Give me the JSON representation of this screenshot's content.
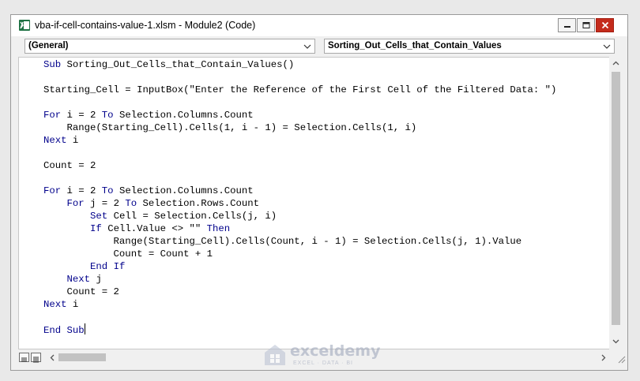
{
  "window": {
    "title": "vba-if-cell-contains-value-1.xlsm - Module2 (Code)"
  },
  "dropdowns": {
    "object": "(General)",
    "procedure": "Sorting_Out_Cells_that_Contain_Values"
  },
  "code_lines": [
    [
      {
        "t": "Sub",
        "k": true
      },
      {
        "t": " Sorting_Out_Cells_that_Contain_Values()"
      }
    ],
    [],
    [
      {
        "t": "Starting_Cell = InputBox(\"Enter the Reference of the First Cell of the Filtered Data: \")"
      }
    ],
    [],
    [
      {
        "t": "For",
        "k": true
      },
      {
        "t": " i = 2 "
      },
      {
        "t": "To",
        "k": true
      },
      {
        "t": " Selection.Columns.Count"
      }
    ],
    [
      {
        "t": "    Range(Starting_Cell).Cells(1, i - 1) = Selection.Cells(1, i)"
      }
    ],
    [
      {
        "t": "Next",
        "k": true
      },
      {
        "t": " i"
      }
    ],
    [],
    [
      {
        "t": "Count = 2"
      }
    ],
    [],
    [
      {
        "t": "For",
        "k": true
      },
      {
        "t": " i = 2 "
      },
      {
        "t": "To",
        "k": true
      },
      {
        "t": " Selection.Columns.Count"
      }
    ],
    [
      {
        "t": "    "
      },
      {
        "t": "For",
        "k": true
      },
      {
        "t": " j = 2 "
      },
      {
        "t": "To",
        "k": true
      },
      {
        "t": " Selection.Rows.Count"
      }
    ],
    [
      {
        "t": "        "
      },
      {
        "t": "Set",
        "k": true
      },
      {
        "t": " Cell = Selection.Cells(j, i)"
      }
    ],
    [
      {
        "t": "        "
      },
      {
        "t": "If",
        "k": true
      },
      {
        "t": " Cell.Value <> \"\" "
      },
      {
        "t": "Then",
        "k": true
      }
    ],
    [
      {
        "t": "            Range(Starting_Cell).Cells(Count, i - 1) = Selection.Cells(j, 1).Value"
      }
    ],
    [
      {
        "t": "            Count = Count + 1"
      }
    ],
    [
      {
        "t": "        "
      },
      {
        "t": "End If",
        "k": true
      }
    ],
    [
      {
        "t": "    "
      },
      {
        "t": "Next",
        "k": true
      },
      {
        "t": " j"
      }
    ],
    [
      {
        "t": "    Count = 2"
      }
    ],
    [
      {
        "t": "Next",
        "k": true
      },
      {
        "t": " i"
      }
    ],
    [],
    [
      {
        "t": "End Sub",
        "k": true
      }
    ]
  ],
  "watermark": {
    "name": "exceldemy",
    "tagline": "EXCEL · DATA · BI"
  },
  "colors": {
    "keyword": "#00008b",
    "close_button": "#c42b1c",
    "title_bar": "#ffffff"
  },
  "icons": [
    "excel-app-icon",
    "minimize-icon",
    "maximize-icon",
    "close-icon",
    "chevron-down-icon",
    "scroll-up-icon",
    "scroll-down-icon",
    "scroll-left-icon",
    "scroll-right-icon",
    "procedure-view-icon",
    "full-module-view-icon",
    "resize-grip-icon"
  ]
}
